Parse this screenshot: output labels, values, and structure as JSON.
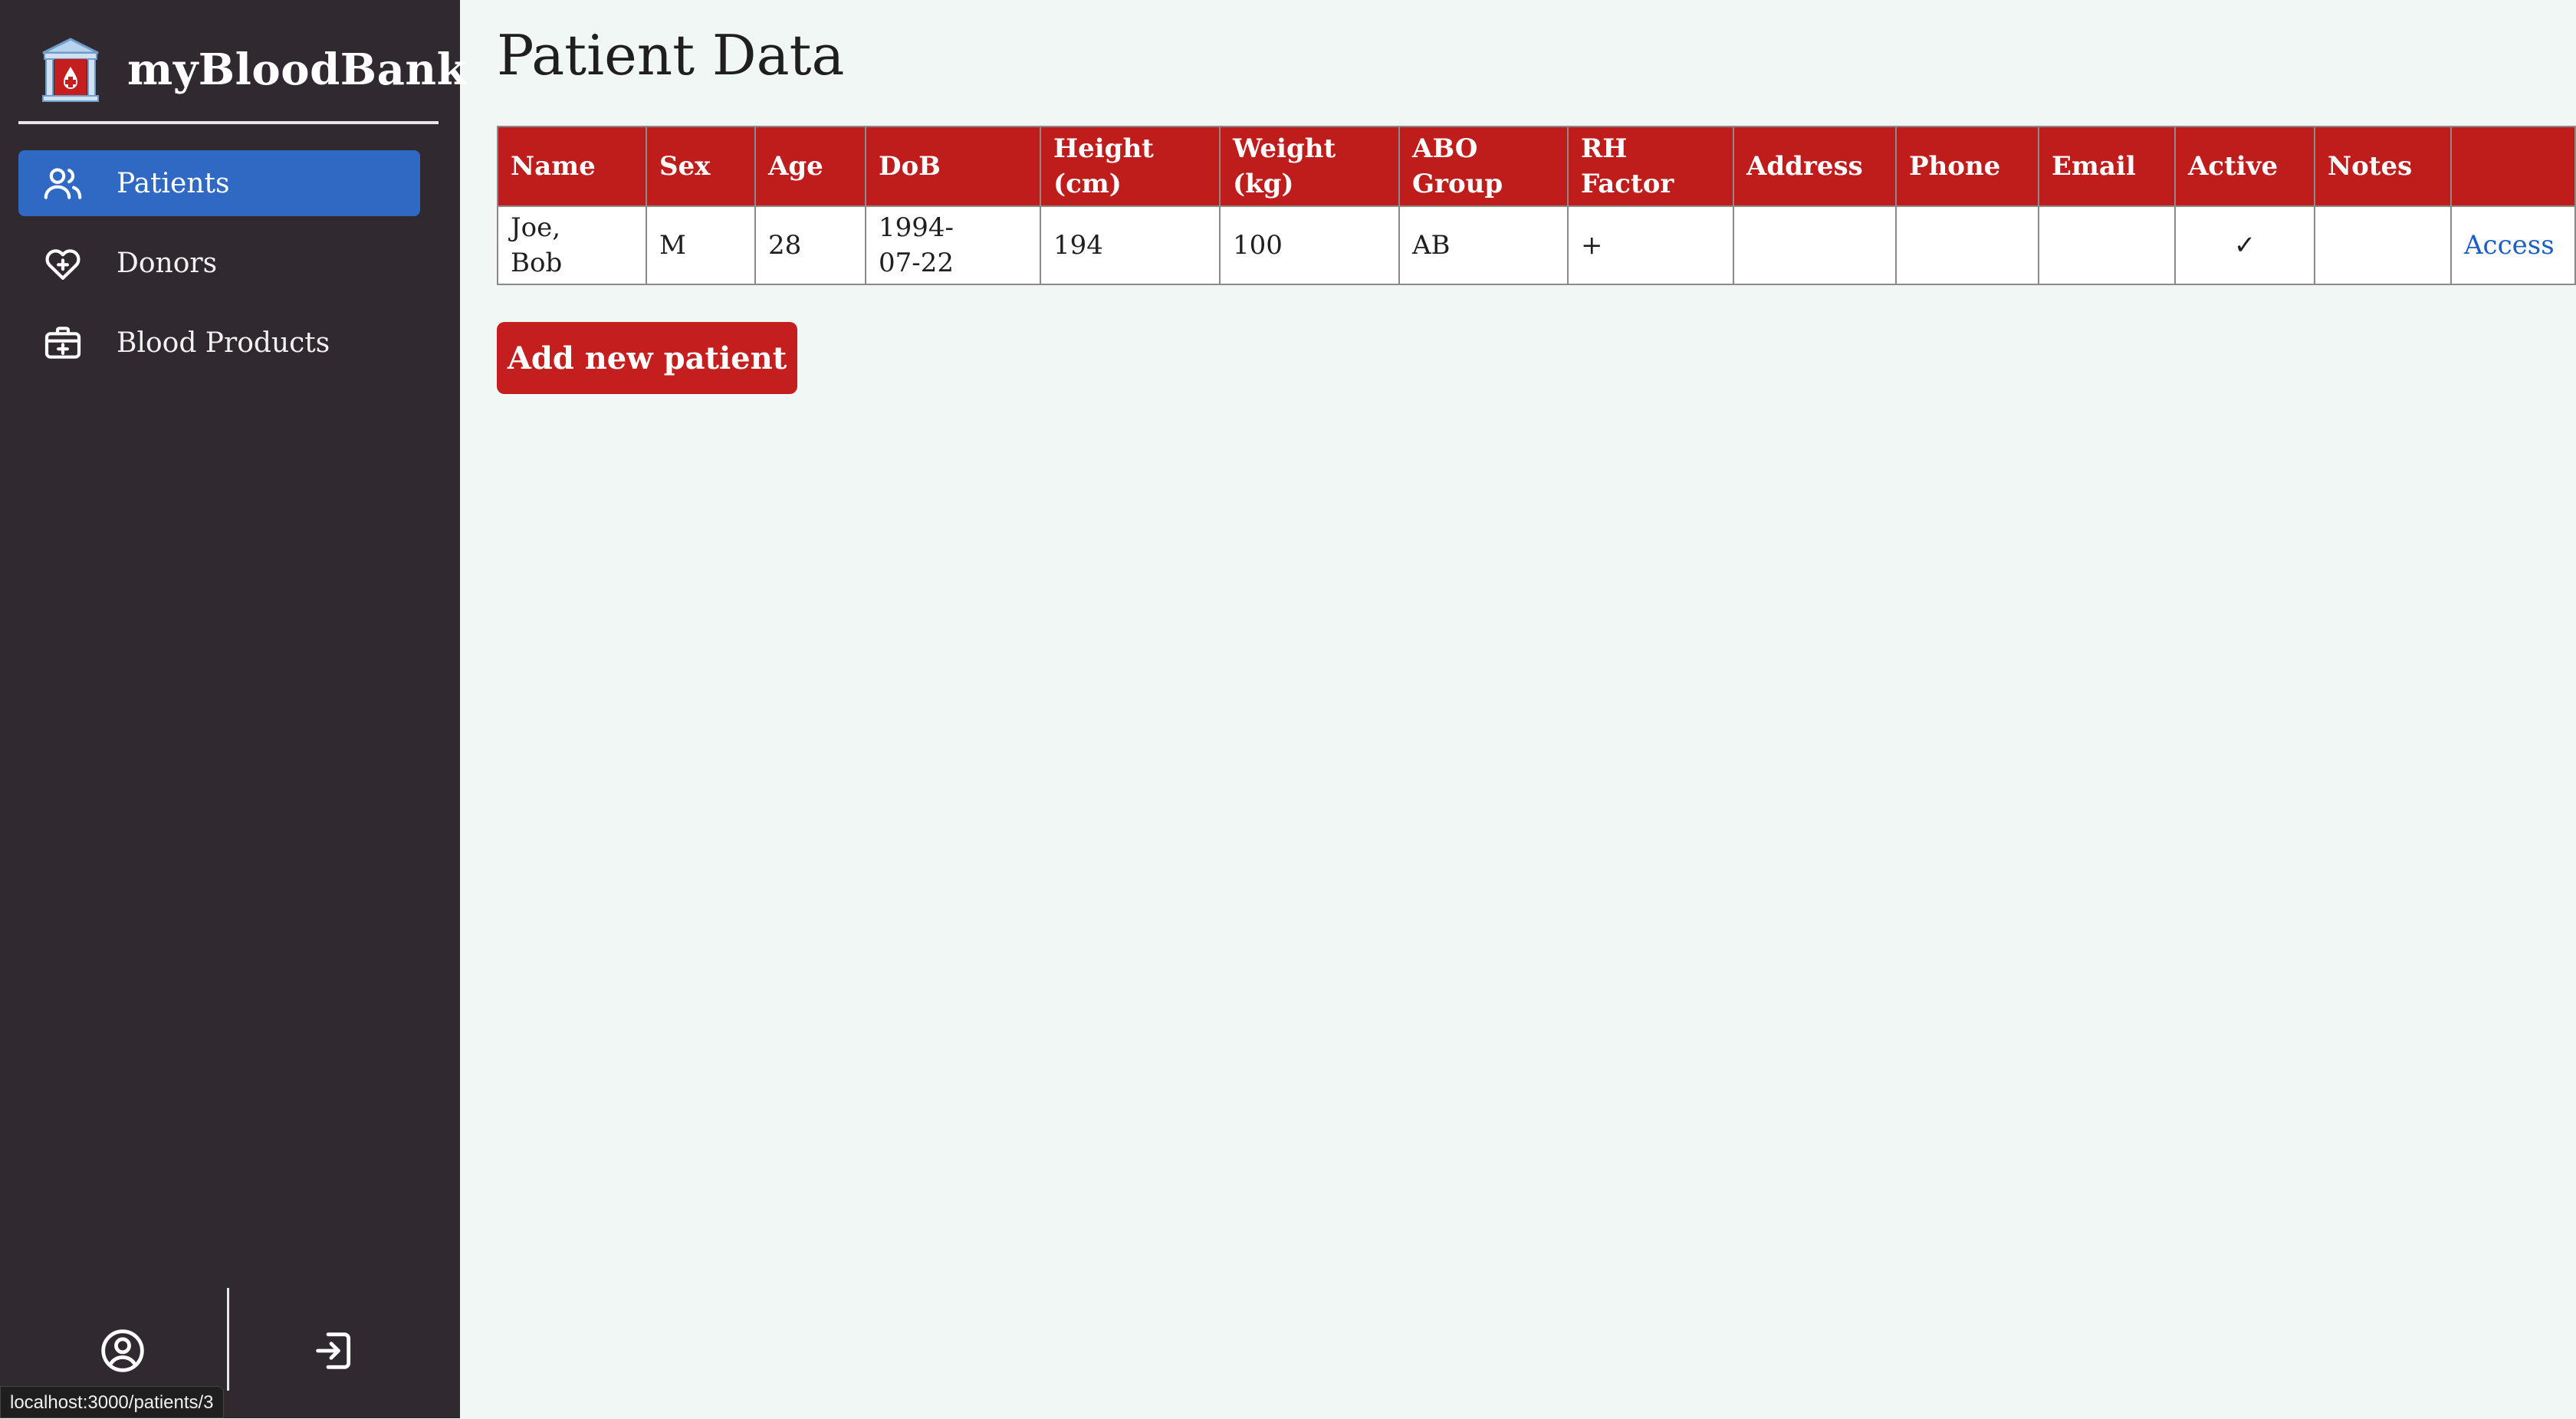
{
  "app": {
    "title": "myBloodBank"
  },
  "sidebar": {
    "items": [
      {
        "label": "Patients",
        "icon": "users-icon",
        "active": true
      },
      {
        "label": "Donors",
        "icon": "heart-plus-icon",
        "active": false
      },
      {
        "label": "Blood Products",
        "icon": "medical-kit-icon",
        "active": false
      }
    ],
    "bottom": {
      "profile_icon": "user-circle-icon",
      "logout_icon": "logout-icon"
    }
  },
  "status_bar": {
    "url": "localhost:3000/patients/3"
  },
  "page": {
    "title": "Patient Data"
  },
  "table": {
    "headers": {
      "name": "Name",
      "sex": "Sex",
      "age": "Age",
      "dob": "DoB",
      "height_1": "Height",
      "height_2": "(cm)",
      "weight_1": "Weight",
      "weight_2": "(kg)",
      "abo_1": "ABO",
      "abo_2": "Group",
      "rh_1": "RH",
      "rh_2": "Factor",
      "address": "Address",
      "phone": "Phone",
      "email": "Email",
      "active": "Active",
      "notes": "Notes",
      "action": ""
    },
    "rows": [
      {
        "name_1": "Joe,",
        "name_2": "Bob",
        "sex": "M",
        "age": "28",
        "dob_1": "1994-",
        "dob_2": "07-22",
        "height": "194",
        "weight": "100",
        "abo": "AB",
        "rh": "+",
        "address": "",
        "phone": "",
        "email": "",
        "active": "✓",
        "notes": "",
        "action": "Access"
      }
    ]
  },
  "actions": {
    "add_label": "Add new patient"
  },
  "colors": {
    "sidebar_bg": "#312930",
    "active_nav": "#2f69c4",
    "header_red": "#bf1c1c",
    "button_red": "#c41e1e",
    "link_blue": "#1b5fc2",
    "page_bg": "#f1f7f5"
  }
}
